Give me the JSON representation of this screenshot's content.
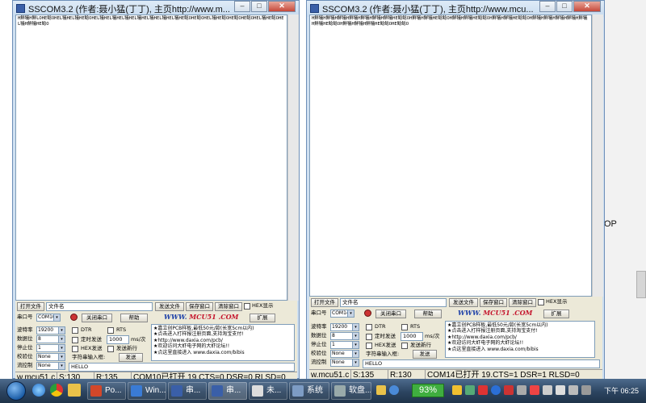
{
  "background": {
    "text": "OP"
  },
  "left_window": {
    "title": "SSCOM3.2 (作者:聂小猛(丁丁), 主页http://www.m...",
    "receive_text": "H鮮犠H鮮LOHE鲶OHEL犠HEL犠HE鲶OHEL犠HEL犠HEL犠HEL犠HEL犠HEL犠HEL犠HE鲶OHE鲶OHEL犠HE鲶OHE鲶OHE鲶OHEL犠HE鲶OHEL犠H鮮犠HE鲶O",
    "open_file_btn": "打开文件",
    "filename": "文件名",
    "send_file_btn": "发送文件",
    "save_window_btn": "保存窗口",
    "clear_window_btn": "清除窗口",
    "hex_display_label": "HEX显示",
    "port_label": "串口号",
    "port_value": "COM10",
    "close_port_btn": "关闭串口",
    "help_btn": "帮助",
    "logo_www": "WWW.",
    "logo_mcu": "MCU51",
    "logo_com": ".COM",
    "expand_btn": "扩展",
    "baud_label": "波特率",
    "baud_value": "19200",
    "data_bits_label": "数据位",
    "data_bits_value": "8",
    "stop_bits_label": "停止位",
    "stop_bits_value": "1",
    "parity_label": "校验位",
    "parity_value": "None",
    "flow_label": "流控制",
    "flow_value": "None",
    "dtr_label": "DTR",
    "rts_label": "RTS",
    "timed_send_label": "定时发送",
    "interval_value": "1000",
    "interval_unit": "ms/次",
    "hex_send_label": "HEX发送",
    "send_newline_label": "发送新行",
    "input_label": "字符串输入框:",
    "send_btn": "发送",
    "send_text": "HELLO",
    "ad_lines": [
      "★嘉立创PCB样板,最低50元/款(长宽5cm以内)",
      "★点击进入打样报注册页面,支持淘宝支付!",
      "★http://www.daxia.com/pcb/",
      "★欢迎访问大虾电子网的大虾论坛!!",
      "★点这里直接进入 www.daxia.com/bibis"
    ],
    "status": {
      "site": "w.mcu51.c",
      "s": "S:130",
      "r": "R:135",
      "port_status": "COM10已打开  19.CTS=0 DSR=0 RLSD=0"
    }
  },
  "right_window": {
    "title": "SSCOM3.2 (作者:聂小猛(丁丁), 主页http://www.mcu...",
    "receive_text": "H鮮犠H鮮犠H鮮犠H鮮犠H鮮犠H鮮犠H鮮犠HE鲶鲶OH鮮犠H鮮犠HE鲶鲶OH鮮犠H鮮犠HE鲶鲶OH鮮犠H鮮犠HE鲶鲶OH鮮犠H鮮犠H鮮犠H鮮犠H鮮犠H鮮犠HE鲶鲶OH鮮犠H鮮犠H鮮犠HE鲶鲶OHE鲶鲶O",
    "open_file_btn": "打开文件",
    "filename": "文件名",
    "send_file_btn": "发送文件",
    "save_window_btn": "保存窗口",
    "clear_window_btn": "清除窗口",
    "hex_display_label": "HEX显示",
    "port_label": "串口号",
    "port_value": "COM14",
    "close_port_btn": "关闭串口",
    "help_btn": "帮助",
    "logo_www": "WWW.",
    "logo_mcu": "MCU51",
    "logo_com": ".COM",
    "expand_btn": "扩展",
    "baud_label": "波特率",
    "baud_value": "19200",
    "data_bits_label": "数据位",
    "data_bits_value": "8",
    "stop_bits_label": "停止位",
    "stop_bits_value": "1",
    "parity_label": "校验位",
    "parity_value": "None",
    "flow_label": "流控制",
    "flow_value": "None",
    "dtr_label": "DTR",
    "rts_label": "RTS",
    "timed_send_label": "定时发送",
    "interval_value": "1000",
    "interval_unit": "ms/次",
    "hex_send_label": "HEX发送",
    "send_newline_label": "发送新行",
    "input_label": "字符串输入框:",
    "send_btn": "发送",
    "send_text": "HELLO",
    "ad_lines": [
      "★嘉立创PCB样板,最低50元/款(长宽5cm以内)",
      "★点击进入打样报注册页面,支持淘宝支付!",
      "★http://www.daxia.com/pcb/",
      "★欢迎访问大虾电子网的大虾论坛!!",
      "★点这里直接进入 www.daxia.com/bibis"
    ],
    "status": {
      "site": "w.mcu51.c",
      "s": "S:135",
      "r": "R:130",
      "port_status": "COM14已打开  19.CTS=1 DSR=1 RLSD=0"
    }
  },
  "taskbar": {
    "items": [
      "Po...",
      "Win...",
      "串...",
      "串...",
      "未...",
      "系统",
      "软盘..."
    ],
    "battery": "93%",
    "clock": "下午 06:25"
  },
  "colors": {
    "titlebar": "#cfe0f1",
    "panel": "#ece9d8",
    "logo_blue": "#1c3fa8",
    "logo_red": "#c4122a",
    "taskbar": "#2c4460",
    "battery": "#3fae3f"
  }
}
